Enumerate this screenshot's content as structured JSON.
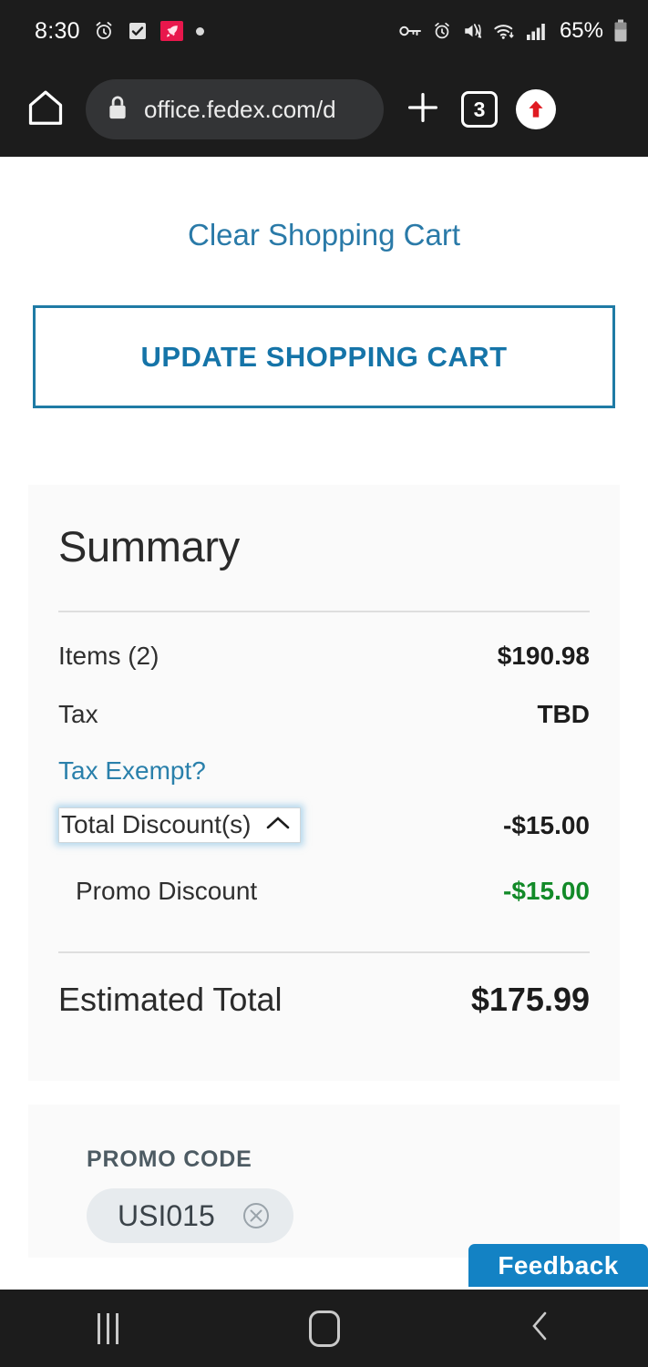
{
  "status_bar": {
    "time": "8:30",
    "battery_percent": "65%",
    "icons_left": [
      "alarm-icon",
      "tasks-checkbox-icon",
      "rocket-badge-icon",
      "dot-icon"
    ],
    "icons_right": [
      "vpn-key-icon",
      "alarm-icon",
      "mute-vibrate-icon",
      "wifi-icon",
      "cellular-signal-icon",
      "battery-icon"
    ]
  },
  "browser": {
    "url": "office.fedex.com/d",
    "tab_count": "3",
    "home_icon": "home-icon",
    "lock_icon": "lock-icon",
    "new_tab_icon": "plus-icon",
    "update_icon": "update-arrow-icon"
  },
  "page": {
    "clear_cart_link": "Clear Shopping Cart",
    "update_cart_button": "UPDATE SHOPPING CART",
    "summary": {
      "title": "Summary",
      "rows": [
        {
          "label": "Items (2)",
          "value": "$190.98"
        },
        {
          "label": "Tax",
          "value": "TBD"
        }
      ],
      "tax_exempt_link": "Tax Exempt?",
      "discount": {
        "label": "Total Discount(s)",
        "value": "-$15.00",
        "chevron_icon": "chevron-up-icon",
        "expanded": true,
        "items": [
          {
            "label": "Promo Discount",
            "value": "-$15.00"
          }
        ]
      },
      "total": {
        "label": "Estimated Total",
        "value": "$175.99"
      }
    },
    "promo": {
      "label": "PROMO CODE",
      "code": "USI015",
      "remove_icon": "circle-x-icon"
    },
    "feedback_tab": "Feedback"
  },
  "colors": {
    "link_blue": "#2a7aa8",
    "button_blue": "#1574a8",
    "discount_green": "#128a28",
    "feedback_blue": "#1382c4",
    "focus_glow": "#78b9e1"
  },
  "nav_bar": {
    "recents_icon": "recents-icon",
    "home_icon": "home-square-icon",
    "back_icon": "back-chevron-icon"
  }
}
